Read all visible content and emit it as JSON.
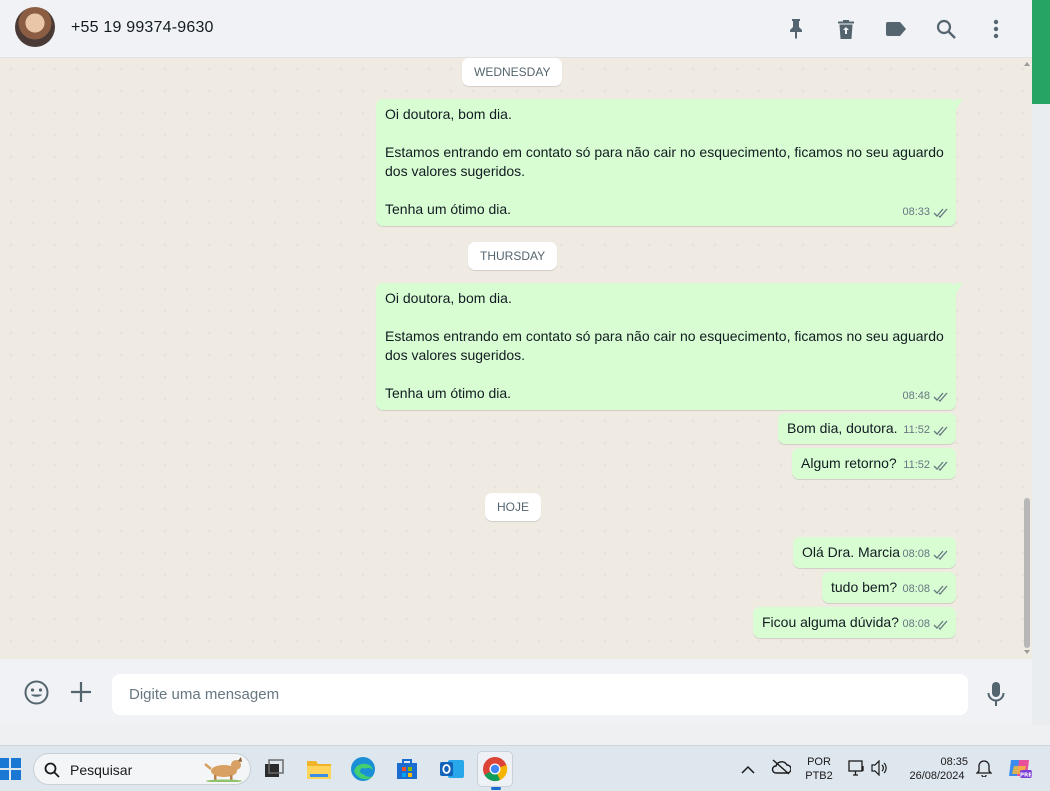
{
  "header": {
    "contact_name": "+55 19 99374-9630",
    "icons": [
      "pin-icon",
      "delete-icon",
      "label-icon",
      "search-icon",
      "menu-icon"
    ]
  },
  "chat": {
    "days": [
      {
        "label": "WEDNESDAY"
      },
      {
        "label": "THURSDAY"
      },
      {
        "label": "HOJE"
      }
    ],
    "messages": [
      {
        "text": "Oi doutora, bom dia.\n\nEstamos entrando em contato só para não cair no esquecimento, ficamos no seu aguardo\ndos valores sugeridos.\n\nTenha um ótimo dia.",
        "time": "08:33",
        "status": "read"
      },
      {
        "text": "Oi doutora, bom dia.\n\nEstamos entrando em contato só para não cair no esquecimento, ficamos no seu aguardo\ndos valores sugeridos.\n\nTenha um ótimo dia.",
        "time": "08:48",
        "status": "read"
      },
      {
        "text": "Bom dia, doutora.",
        "time": "11:52",
        "status": "read"
      },
      {
        "text": "Algum retorno?",
        "time": "11:52",
        "status": "read"
      },
      {
        "text": "Olá Dra. Marcia",
        "time": "08:08",
        "status": "read"
      },
      {
        "text": "tudo bem?",
        "time": "08:08",
        "status": "read"
      },
      {
        "text": "Ficou alguma dúvida?",
        "time": "08:08",
        "status": "read"
      }
    ]
  },
  "composer": {
    "placeholder": "Digite uma mensagem",
    "icons": [
      "emoji-icon",
      "attach-plus-icon",
      "microphone-icon"
    ]
  },
  "taskbar": {
    "search_placeholder": "Pesquisar",
    "apps": [
      "windows-start-icon",
      "task-view-icon",
      "file-explorer-icon",
      "edge-icon",
      "store-icon",
      "outlook-icon",
      "chrome-icon"
    ],
    "tray": {
      "language": "POR",
      "keyboard": "PTB2",
      "time": "08:35",
      "date": "26/08/2024"
    }
  },
  "colors": {
    "accent_green": "#25a463",
    "bubble_out": "#d9fdd3",
    "chat_bg": "#efeae2",
    "read_tick": "#667781"
  }
}
